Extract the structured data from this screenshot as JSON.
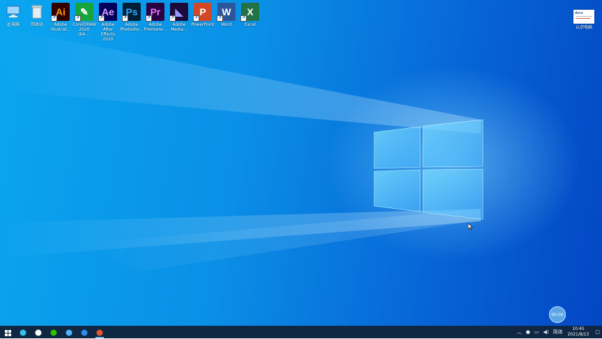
{
  "desktop": {
    "icons": [
      {
        "id": "this-pc",
        "label": "此电脑",
        "glyph": "",
        "bg": "#3a8fd6",
        "fg": "#fff",
        "shortcut": false
      },
      {
        "id": "recycle-bin",
        "label": "回收站",
        "glyph": "",
        "bg": "#dfe9f2",
        "fg": "#333",
        "shortcut": false
      },
      {
        "id": "illustrator",
        "label": "Adobe\nIllustrat...",
        "glyph": "Ai",
        "bg": "#330000",
        "fg": "#ff9a00",
        "shortcut": true
      },
      {
        "id": "coreldraw",
        "label": "CorelDRAW\n2020 (64-...",
        "glyph": "✎",
        "bg": "#17a43a",
        "fg": "#fff",
        "shortcut": true
      },
      {
        "id": "after-effects",
        "label": "Adobe After\nEffects 2020",
        "glyph": "Ae",
        "bg": "#00005b",
        "fg": "#d8a1ff",
        "shortcut": true
      },
      {
        "id": "photoshop",
        "label": "Adobe\nPhotosho...",
        "glyph": "Ps",
        "bg": "#001e36",
        "fg": "#31a8ff",
        "shortcut": true
      },
      {
        "id": "premiere",
        "label": "Adobe\nPremiere...",
        "glyph": "Pr",
        "bg": "#2a0040",
        "fg": "#e77bff",
        "shortcut": true
      },
      {
        "id": "media-encoder",
        "label": "Adobe\nMedia...",
        "glyph": "◣",
        "bg": "#1b0a3a",
        "fg": "#9999ff",
        "shortcut": true
      },
      {
        "id": "powerpoint",
        "label": "PowerPoint",
        "glyph": "P",
        "bg": "#d24726",
        "fg": "#fff",
        "shortcut": true
      },
      {
        "id": "word",
        "label": "Word",
        "glyph": "W",
        "bg": "#2b579a",
        "fg": "#fff",
        "shortcut": true
      },
      {
        "id": "excel",
        "label": "Excel",
        "glyph": "X",
        "bg": "#217346",
        "fg": "#fff",
        "shortcut": true
      }
    ],
    "file_icon": {
      "label": "认识电脑",
      "badge": "docx"
    },
    "record_button": "00:00"
  },
  "taskbar": {
    "items": [
      {
        "name": "start-icon",
        "color": "#ffffff",
        "active": false
      },
      {
        "name": "edge-icon",
        "color": "#35c1f1",
        "active": false
      },
      {
        "name": "settings-icon",
        "color": "#ffffff",
        "active": false
      },
      {
        "name": "wechat-icon",
        "color": "#2dc100",
        "active": false
      },
      {
        "name": "search-app-icon",
        "color": "#4fb3ff",
        "active": false
      },
      {
        "name": "app-k-icon",
        "color": "#2f8cf0",
        "active": false
      },
      {
        "name": "recorder-icon",
        "color": "#e8542f",
        "active": true
      }
    ],
    "tray": {
      "ime": "简体",
      "time": "10:45",
      "date": "2021/8/13"
    }
  }
}
